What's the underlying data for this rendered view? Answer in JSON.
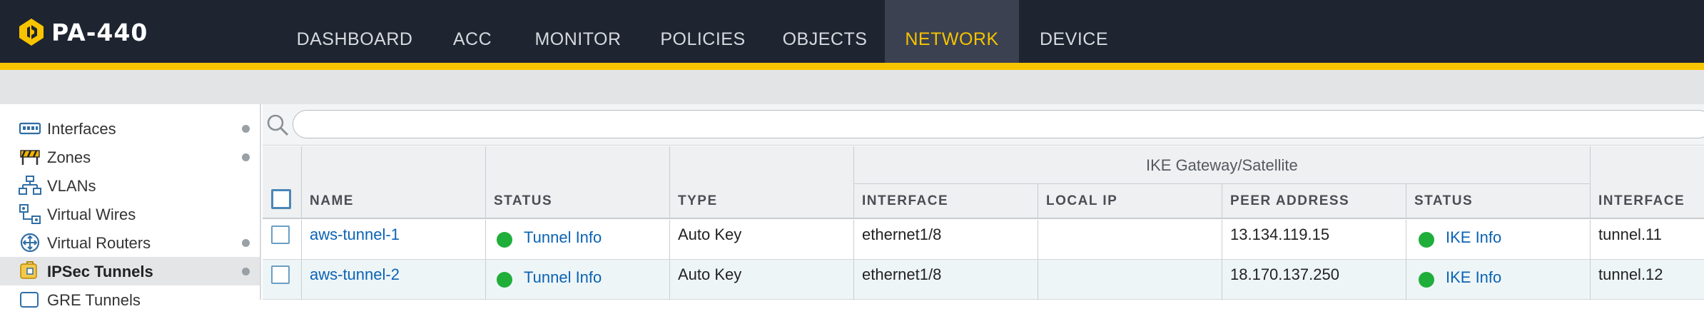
{
  "header": {
    "device_name": "PA-440",
    "nav": [
      {
        "label": "DASHBOARD",
        "active": false
      },
      {
        "label": "ACC",
        "active": false
      },
      {
        "label": "MONITOR",
        "active": false
      },
      {
        "label": "POLICIES",
        "active": false
      },
      {
        "label": "OBJECTS",
        "active": false
      },
      {
        "label": "NETWORK",
        "active": true
      },
      {
        "label": "DEVICE",
        "active": false
      }
    ]
  },
  "sidebar": {
    "items": [
      {
        "label": "Interfaces",
        "icon": "interfaces-icon",
        "dot": true,
        "active": false
      },
      {
        "label": "Zones",
        "icon": "zones-icon",
        "dot": true,
        "active": false
      },
      {
        "label": "VLANs",
        "icon": "vlans-icon",
        "dot": false,
        "active": false
      },
      {
        "label": "Virtual Wires",
        "icon": "virtual-wires-icon",
        "dot": false,
        "active": false
      },
      {
        "label": "Virtual Routers",
        "icon": "virtual-routers-icon",
        "dot": true,
        "active": false
      },
      {
        "label": "IPSec Tunnels",
        "icon": "ipsec-tunnels-icon",
        "dot": true,
        "active": true
      },
      {
        "label": "GRE Tunnels",
        "icon": "gre-tunnels-icon",
        "dot": false,
        "active": false
      }
    ]
  },
  "search": {
    "value": "",
    "placeholder": ""
  },
  "table": {
    "group_header": "IKE Gateway/Satellite",
    "columns": [
      "NAME",
      "STATUS",
      "TYPE",
      "INTERFACE",
      "LOCAL IP",
      "PEER ADDRESS",
      "STATUS",
      "INTERFACE"
    ],
    "rows": [
      {
        "name": "aws-tunnel-1",
        "status": "Tunnel Info",
        "type": "Auto Key",
        "interface": "ethernet1/8",
        "local_ip": "",
        "peer_address": "13.134.119.15",
        "ike_status": "IKE Info",
        "tunnel_interface": "tunnel.11"
      },
      {
        "name": "aws-tunnel-2",
        "status": "Tunnel Info",
        "type": "Auto Key",
        "interface": "ethernet1/8",
        "local_ip": "",
        "peer_address": "18.170.137.250",
        "ike_status": "IKE Info",
        "tunnel_interface": "tunnel.12"
      }
    ]
  },
  "colors": {
    "topbar": "#1e2430",
    "accent": "#f8c400",
    "active_tab_text": "#f5c400",
    "link": "#0a63b4",
    "status_ok": "#1fae3a"
  }
}
